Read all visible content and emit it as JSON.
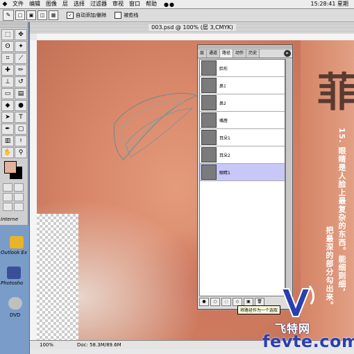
{
  "menubar": {
    "items": [
      "文件",
      "编辑",
      "图像",
      "层",
      "选择",
      "过滤器",
      "审视",
      "窗口",
      "帮助"
    ],
    "clock": "15:28:41 星期"
  },
  "options": {
    "checkbox1_label": "自动添加/删除",
    "checkbox2_label": "被愈线"
  },
  "desktop": {
    "labels": [
      "Interne",
      "Outlook Ex",
      "Photosho",
      "DVD"
    ]
  },
  "document": {
    "title": "003.psd @ 100% (层 3,CMYK)",
    "zoom": "100%",
    "doc_size": "Doc: 58.3M/89.6M"
  },
  "artwork": {
    "caption_line1": "15. 眼睛是人脸上最复杂的东西。能细则细，",
    "caption_line2": "把最深的部分勾出来。",
    "big_char": "菲"
  },
  "paths_panel": {
    "tabs": [
      "层",
      "通道",
      "路径",
      "动作",
      "历史"
    ],
    "active_tab": "路径",
    "rows": [
      {
        "name": "脸形",
        "selected": false
      },
      {
        "name": "鼻1",
        "selected": false
      },
      {
        "name": "鼻2",
        "selected": false
      },
      {
        "name": "嘴唇",
        "selected": false
      },
      {
        "name": "耳朵1",
        "selected": false
      },
      {
        "name": "耳朵2",
        "selected": false
      },
      {
        "name": "眼睛1",
        "selected": true
      }
    ],
    "tooltip": "将路径作为一个选取"
  },
  "watermark": {
    "cn": "飞特网",
    "en": "fevte.com"
  },
  "colors": {
    "foreground": "#e4b29b",
    "background": "#000000",
    "selected_row": "#c8c8f8"
  }
}
